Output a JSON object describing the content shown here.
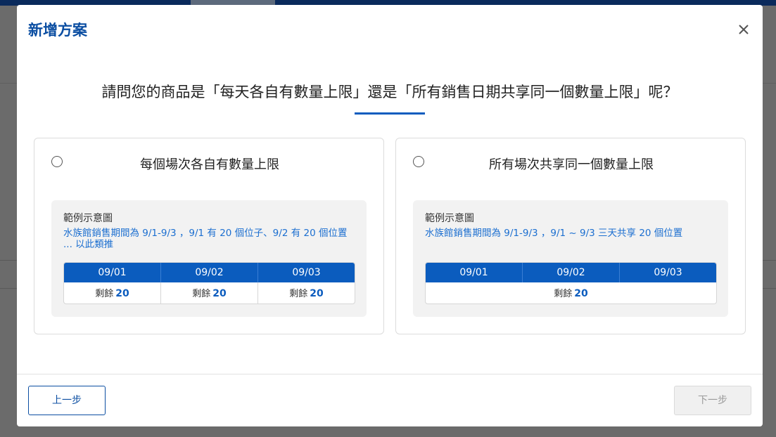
{
  "modal": {
    "title": "新增方案",
    "close_icon": "close-icon",
    "question": "請問您的商品是「每天各自有數量上限」還是「所有銷售日期共享同一個數量上限」呢？"
  },
  "options": [
    {
      "label": "每個場次各自有數量上限",
      "example_title": "範例示意圖",
      "example_desc": "水族館銷售期間為 9/1-9/3 ，9/1 有 20 個位子、9/2 有 20 個位置 ... 以此類推",
      "dates": [
        "09/01",
        "09/02",
        "09/03"
      ],
      "remaining_label": "剩餘",
      "remaining": [
        "20",
        "20",
        "20"
      ]
    },
    {
      "label": "所有場次共享同一個數量上限",
      "example_title": "範例示意圖",
      "example_desc": "水族館銷售期間為 9/1-9/3 ，9/1 ~ 9/3 三天共享 20 個位置",
      "dates": [
        "09/01",
        "09/02",
        "09/03"
      ],
      "remaining_label": "剩餘",
      "remaining_shared": "20"
    }
  ],
  "footer": {
    "prev_label": "上一步",
    "next_label": "下一步"
  },
  "colors": {
    "accent": "#0b5cbe",
    "title": "#0b4ea2",
    "example_text": "#1c6fd0",
    "disabled": "#f0f0f0"
  }
}
